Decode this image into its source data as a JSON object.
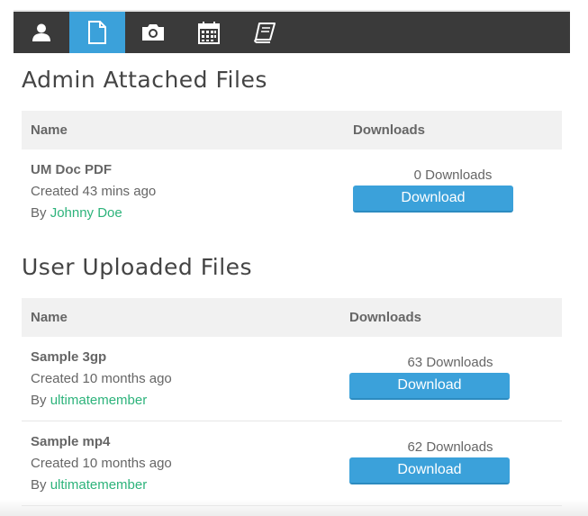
{
  "tabs": [
    {
      "id": "profile",
      "icon": "user-icon",
      "active": false
    },
    {
      "id": "files",
      "icon": "file-icon",
      "active": true
    },
    {
      "id": "photos",
      "icon": "camera-icon",
      "active": false
    },
    {
      "id": "events",
      "icon": "calendar-icon",
      "active": false
    },
    {
      "id": "notes",
      "icon": "book-icon",
      "active": false
    }
  ],
  "colors": {
    "tabbar": "#3a3a3a",
    "accent": "#3ba1da",
    "author_admin": "#2db37b",
    "author_user": "#3ba1da"
  },
  "admin_section": {
    "title": "Admin Attached Files",
    "columns": {
      "name": "Name",
      "downloads": "Downloads"
    },
    "files": [
      {
        "name": "UM Doc PDF",
        "created": "Created 43 mins ago",
        "by_prefix": "By",
        "author": "Johnny Doe",
        "downloads": "0 Downloads",
        "button": "Download"
      }
    ]
  },
  "user_section": {
    "title": "User Uploaded Files",
    "columns": {
      "name": "Name",
      "downloads": "Downloads"
    },
    "files": [
      {
        "name": "Sample 3gp",
        "created": "Created 10 months ago",
        "by_prefix": "By",
        "author": "ultimatemember",
        "downloads": "63 Downloads",
        "button": "Download"
      },
      {
        "name": "Sample mp4",
        "created": "Created 10 months ago",
        "by_prefix": "By",
        "author": "ultimatemember",
        "downloads": "62 Downloads",
        "button": "Download"
      }
    ]
  }
}
